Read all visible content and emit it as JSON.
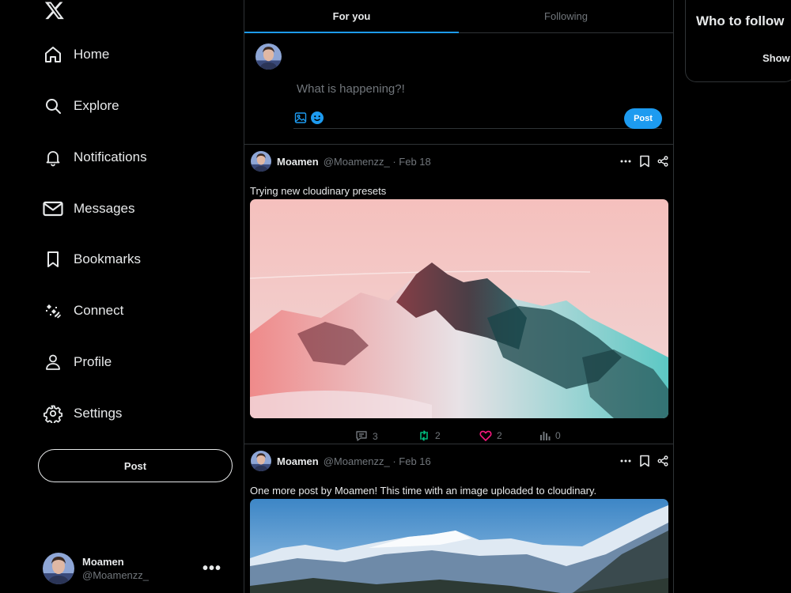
{
  "sidebar": {
    "logo": "x-logo-icon",
    "items": [
      {
        "label": "Home",
        "icon": "home-icon"
      },
      {
        "label": "Explore",
        "icon": "search-icon"
      },
      {
        "label": "Notifications",
        "icon": "bell-icon"
      },
      {
        "label": "Messages",
        "icon": "mail-icon"
      },
      {
        "label": "Bookmarks",
        "icon": "bookmark-icon"
      },
      {
        "label": "Connect",
        "icon": "connect-icon"
      },
      {
        "label": "Profile",
        "icon": "person-icon"
      },
      {
        "label": "Settings",
        "icon": "gear-icon"
      }
    ],
    "post_label": "Post",
    "account": {
      "name": "Moamen",
      "handle": "@Moamenzz_"
    }
  },
  "tabs": [
    {
      "label": "For you",
      "active": true
    },
    {
      "label": "Following",
      "active": false
    }
  ],
  "composer": {
    "placeholder": "What is happening?!",
    "submit_label": "Post"
  },
  "posts": [
    {
      "author": "Moamen",
      "meta": "@Moamenzz_ · Feb 18",
      "text": "Trying new cloudinary presets",
      "stats": {
        "replies": "3",
        "reposts": "2",
        "likes": "2",
        "views": "0"
      }
    },
    {
      "author": "Moamen",
      "meta": "@Moamenzz_ · Feb 16",
      "text": "One more post by Moamen! This time with an image uploaded to cloudinary."
    }
  ],
  "right": {
    "title": "Who to follow",
    "show_label": "Show"
  },
  "colors": {
    "accent": "#1d9bf0",
    "repost": "#00ba7c",
    "like": "#f91880",
    "muted": "#71767b",
    "border": "#2f3336"
  }
}
